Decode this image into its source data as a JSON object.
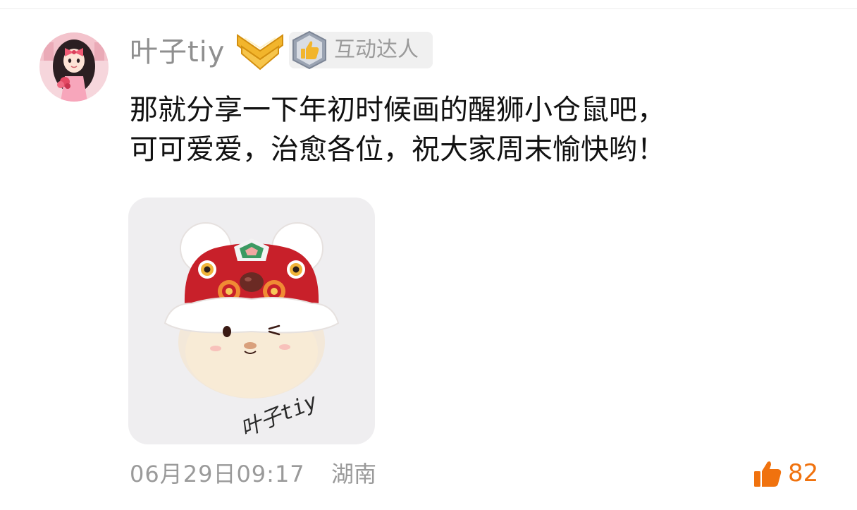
{
  "comment": {
    "username": "叶子tiy",
    "badges": {
      "vip_icon": "gold-chevron-badge-icon",
      "interaction_badge_label": "互动达人",
      "interaction_badge_icon": "thumbs-up-badge-icon"
    },
    "text_lines": [
      "那就分享一下年初时候画的醒狮小仓鼠吧，",
      "可可爱爱，治愈各位，祝大家周末愉快哟！"
    ],
    "image": {
      "watermark": "叶子tiy"
    },
    "footer": {
      "date": "06月29日09:17",
      "location": "湖南",
      "like_count": "82"
    }
  },
  "colors": {
    "username": "#8f8f8f",
    "body_text": "#111111",
    "meta_text": "#9a9a9a",
    "like_accent": "#f0720e",
    "badge_bg": "#f0f0f0"
  }
}
